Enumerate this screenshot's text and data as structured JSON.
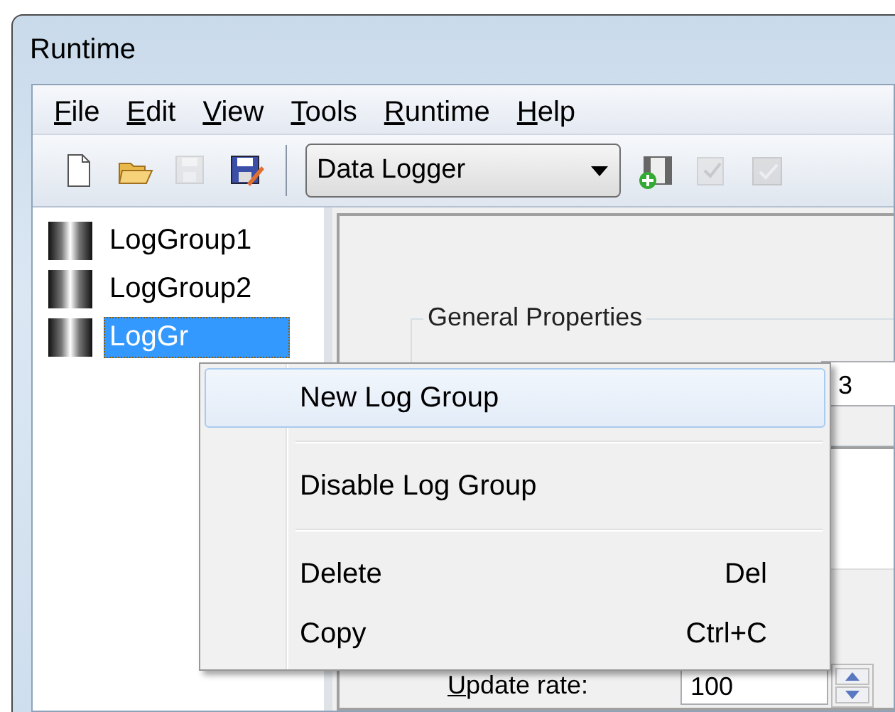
{
  "window": {
    "title": "Runtime"
  },
  "menu_bar": [
    {
      "label": "File"
    },
    {
      "label": "Edit"
    },
    {
      "label": "View"
    },
    {
      "label": "Tools"
    },
    {
      "label": "Runtime"
    },
    {
      "label": "Help"
    }
  ],
  "toolbar": {
    "left_buttons": [
      {
        "kind": "new",
        "disabled": false
      },
      {
        "kind": "open",
        "disabled": false
      },
      {
        "kind": "save",
        "disabled": true
      },
      {
        "kind": "saveas",
        "disabled": false
      }
    ],
    "combo": {
      "value": "Data Logger"
    },
    "right_buttons": [
      {
        "kind": "add",
        "disabled": false
      },
      {
        "kind": "check",
        "disabled": true
      },
      {
        "kind": "checkgrid",
        "disabled": true
      }
    ]
  },
  "tree": {
    "items": [
      {
        "label": "LogGroup1",
        "selected": false
      },
      {
        "label": "LogGroup2",
        "selected": false
      },
      {
        "label": "LogGr",
        "selected": true
      }
    ]
  },
  "properties": {
    "group_title": "General Properties",
    "name_field": {
      "value": "3"
    },
    "update_rate": {
      "label": "Update rate:",
      "value": "100"
    }
  },
  "context_menu": {
    "items": [
      {
        "kind": "item",
        "label": "New Log Group",
        "selected": true
      },
      {
        "kind": "separator"
      },
      {
        "kind": "item",
        "label": "Disable Log Group",
        "selected": false
      },
      {
        "kind": "separator"
      },
      {
        "kind": "item",
        "label": "Delete",
        "shortcut": "Del",
        "selected": false
      },
      {
        "kind": "item",
        "label": "Copy",
        "shortcut": "Ctrl+C",
        "selected": false
      }
    ]
  }
}
